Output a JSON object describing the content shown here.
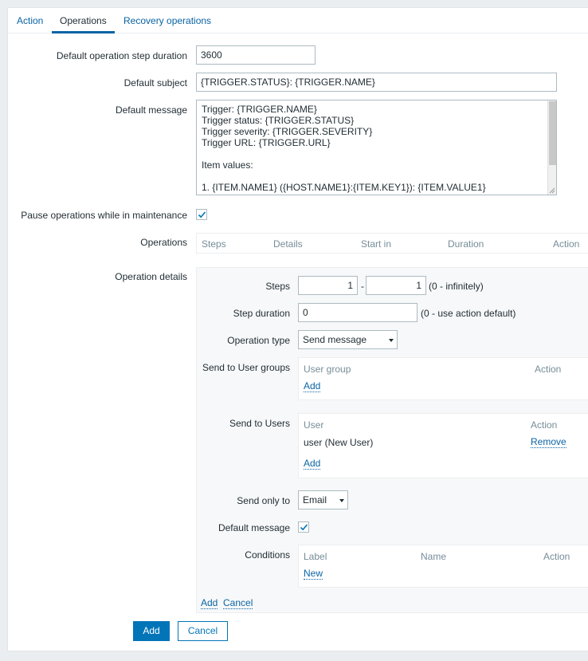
{
  "tabs": [
    {
      "label": "Action"
    },
    {
      "label": "Operations"
    },
    {
      "label": "Recovery operations"
    }
  ],
  "form": {
    "step_duration_label": "Default operation step duration",
    "step_duration_value": "3600",
    "subject_label": "Default subject",
    "subject_value": "{TRIGGER.STATUS}: {TRIGGER.NAME}",
    "message_label": "Default message",
    "message_lines": [
      "Trigger: {TRIGGER.NAME}",
      "Trigger status: {TRIGGER.STATUS}",
      "Trigger severity: {TRIGGER.SEVERITY}",
      "Trigger URL: {TRIGGER.URL}",
      "",
      "Item values:",
      "",
      "1. {ITEM.NAME1} ({HOST.NAME1}:{ITEM.KEY1}): {ITEM.VALUE1}"
    ],
    "pause_label": "Pause operations while in maintenance",
    "pause_checked": true,
    "operations_label": "Operations",
    "operations_headers": [
      "Steps",
      "Details",
      "Start in",
      "Duration",
      "Action"
    ],
    "operation_details_label": "Operation details"
  },
  "details": {
    "steps_label": "Steps",
    "steps_from": "1",
    "steps_sep": "-",
    "steps_to": "1",
    "steps_hint": "(0 - infinitely)",
    "step_duration_label": "Step duration",
    "step_duration_value": "0",
    "step_duration_hint": "(0 - use action default)",
    "operation_type_label": "Operation type",
    "operation_type_value": "Send message",
    "user_groups_label": "Send to User groups",
    "user_groups_headers": [
      "User group",
      "Action"
    ],
    "user_groups_add": "Add",
    "users_label": "Send to Users",
    "users_headers": [
      "User",
      "Action"
    ],
    "users_rows": [
      {
        "name": "user (New User)",
        "action": "Remove"
      }
    ],
    "users_add": "Add",
    "send_only_label": "Send only to",
    "send_only_value": "Email",
    "default_message_label": "Default message",
    "default_message_checked": true,
    "conditions_label": "Conditions",
    "conditions_headers": [
      "Label",
      "Name",
      "Action"
    ],
    "conditions_new": "New",
    "add_link": "Add",
    "cancel_link": "Cancel"
  },
  "buttons": {
    "add": "Add",
    "cancel": "Cancel"
  },
  "colors": {
    "accent": "#0275b8",
    "link": "#0a64a4",
    "header_text": "#768d99",
    "background": "#ebeef0"
  }
}
